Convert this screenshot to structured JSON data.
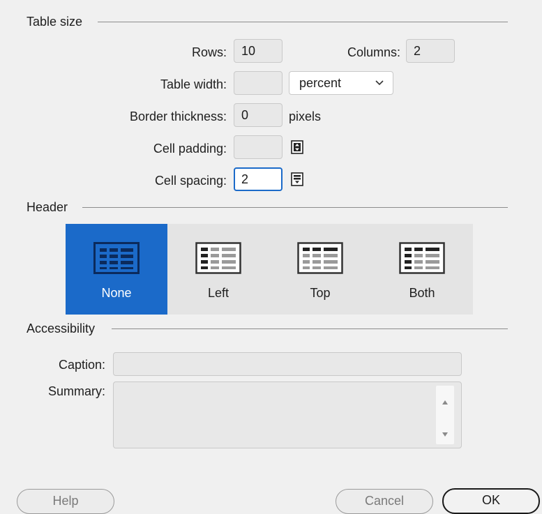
{
  "table_size": {
    "section_title": "Table size",
    "rows_label": "Rows:",
    "rows_value": "10",
    "columns_label": "Columns:",
    "columns_value": "2",
    "table_width_label": "Table width:",
    "table_width_value": "",
    "width_unit": "percent",
    "border_label": "Border thickness:",
    "border_value": "0",
    "border_unit": "pixels",
    "padding_label": "Cell padding:",
    "padding_value": "",
    "spacing_label": "Cell spacing:",
    "spacing_value": "2"
  },
  "header": {
    "section_title": "Header",
    "options": [
      "None",
      "Left",
      "Top",
      "Both"
    ],
    "selected": "None"
  },
  "accessibility": {
    "section_title": "Accessibility",
    "caption_label": "Caption:",
    "caption_value": "",
    "summary_label": "Summary:",
    "summary_value": ""
  },
  "buttons": {
    "help": "Help",
    "cancel": "Cancel",
    "ok": "OK"
  },
  "colors": {
    "accent": "#1b6ac9",
    "background": "#f0f0f0"
  }
}
